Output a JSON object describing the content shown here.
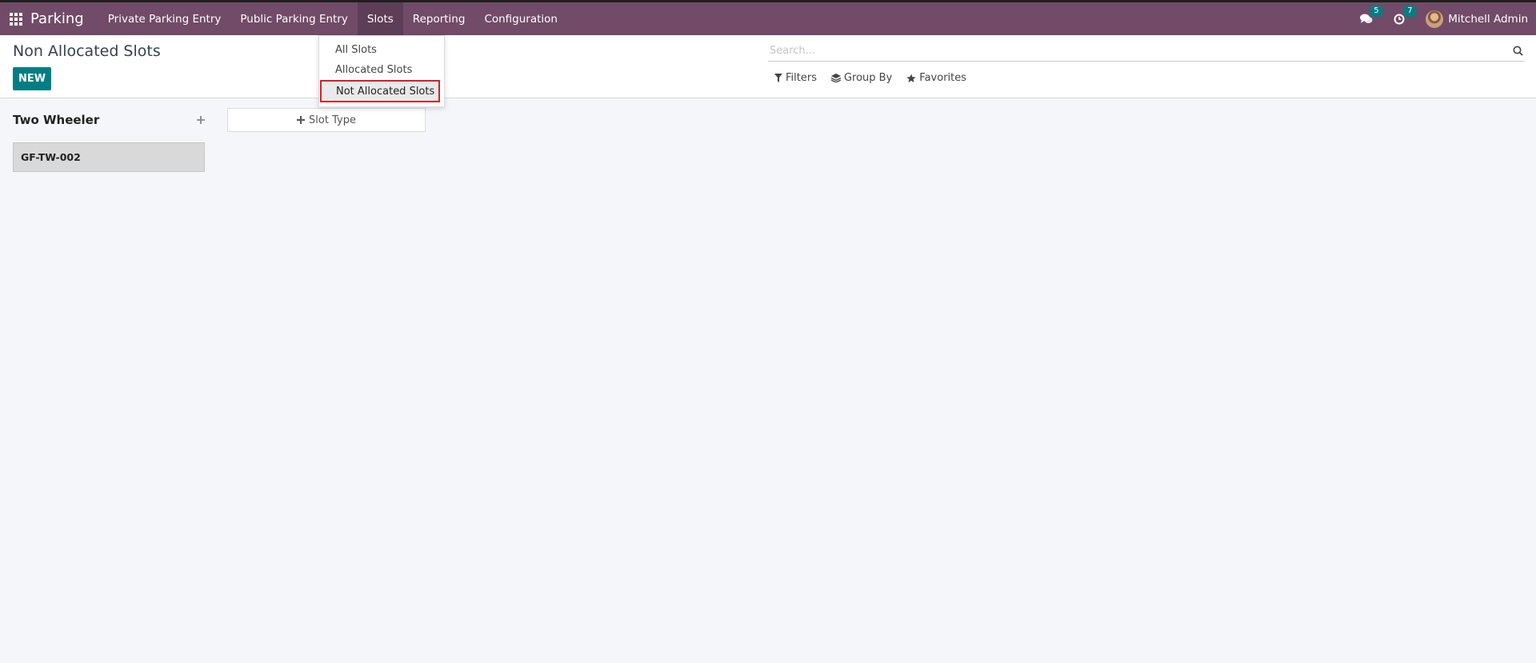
{
  "navbar": {
    "brand": "Parking",
    "menu": [
      {
        "label": "Private Parking Entry"
      },
      {
        "label": "Public Parking Entry"
      },
      {
        "label": "Slots"
      },
      {
        "label": "Reporting"
      },
      {
        "label": "Configuration"
      }
    ],
    "messages_count": "5",
    "activities_count": "7",
    "user_name": "Mitchell Admin"
  },
  "dropdown": {
    "items": [
      "All Slots",
      "Allocated Slots",
      "Not Allocated Slots"
    ]
  },
  "control": {
    "title": "Non Allocated Slots",
    "new_label": "NEW",
    "search_placeholder": "Search...",
    "filters_label": "Filters",
    "groupby_label": "Group By",
    "favorites_label": "Favorites"
  },
  "kanban": {
    "column_title": "Two Wheeler",
    "card_name": "GF-TW-002",
    "add_column_label": "Slot Type"
  },
  "colors": {
    "navbar": "#714b67",
    "primary": "#017e84",
    "highlight": "#d91f26"
  }
}
